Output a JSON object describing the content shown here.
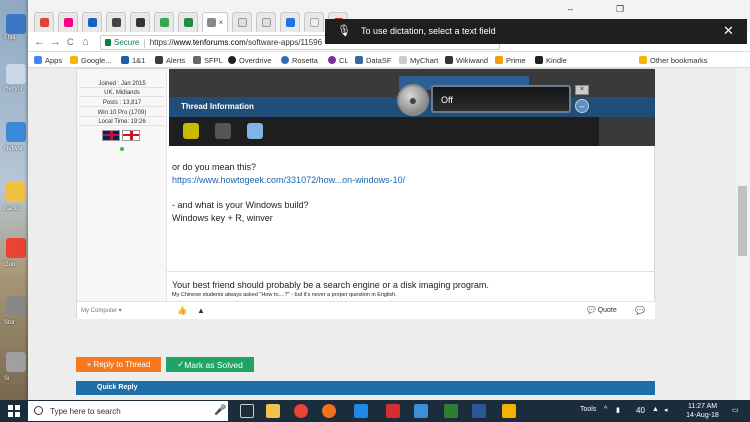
{
  "desktop": {
    "icons": [
      {
        "label": "This",
        "color": "#3a78c2"
      },
      {
        "label": "Recycl",
        "color": "#c9d7e6"
      },
      {
        "label": "Networ",
        "color": "#3a8ad8"
      },
      {
        "label": "Backp",
        "color": "#f0c040"
      },
      {
        "label": "Goo",
        "color": "#e94335"
      },
      {
        "label": "Stor",
        "color": "#888888"
      },
      {
        "label": "Si",
        "color": "#a0a0a0"
      }
    ]
  },
  "browser": {
    "nav": {
      "back": "←",
      "forward": "→",
      "reload": "C",
      "home": "⌂"
    },
    "address": {
      "secure_label": "Secure",
      "url_scheme": "https://",
      "url_domain": "www.tenforums.com",
      "url_path": "/software-apps/11596"
    },
    "bookmarks": [
      {
        "label": "Apps",
        "color": "#4285f4"
      },
      {
        "label": "Google...",
        "color": "#f2b705"
      },
      {
        "label": "1&1",
        "color": "#1e5eab"
      },
      {
        "label": "Alerts",
        "color": "#3a3a3a"
      },
      {
        "label": "SFPL",
        "color": "#666666"
      },
      {
        "label": "Overdrive",
        "color": "#222222"
      },
      {
        "label": "Rosetta",
        "color": "#2c6fb7"
      },
      {
        "label": "CL",
        "color": "#7a2f9f"
      },
      {
        "label": "DataSF",
        "color": "#3a6a9a"
      },
      {
        "label": "MyChart",
        "color": "#cccccc"
      },
      {
        "label": "Wikiwand",
        "color": "#333333"
      },
      {
        "label": "Prime",
        "color": "#f39c12"
      },
      {
        "label": "Kindle",
        "color": "#222222"
      },
      {
        "label": "Other bookmarks",
        "color": "#f2b705"
      }
    ]
  },
  "dictation": {
    "mic_icon": "microphone-icon",
    "message": "To use dictation, select a text field",
    "close": "✕"
  },
  "post": {
    "user": {
      "joined": "Joined : Jan 2015",
      "location": "UK, Midlands",
      "posts": "Posts : 13,817",
      "os": "Win 10 Pro (1709)",
      "local_time": "Local Time: 19:26"
    },
    "screenshot": {
      "thread_info": "Thread Information",
      "speech_state": "Off"
    },
    "body": {
      "line1": "or do you mean this?",
      "link": "https://www.howtogeek.com/331072/how...on-windows-10/",
      "line3": "- and what is your Windows build?",
      "line4": "Windows key + R, winver"
    },
    "signature": {
      "line1": "Your best friend should probably be a search engine or a disk imaging program.",
      "line2": "My Chinese students always asked \"How to....?\" - but it's never a proper question in English."
    },
    "footer": {
      "my_computer": "My Computer",
      "quote": "Quote"
    }
  },
  "actions": {
    "reply": "+ Reply to Thread",
    "solved": "Mark as Solved",
    "quick_reply": "Quick Reply"
  },
  "taskbar": {
    "search_placeholder": "Type here to search",
    "tools_label": "Tools",
    "volume_level": "40",
    "time": "11:27 AM",
    "date": "14-Aug-18"
  }
}
